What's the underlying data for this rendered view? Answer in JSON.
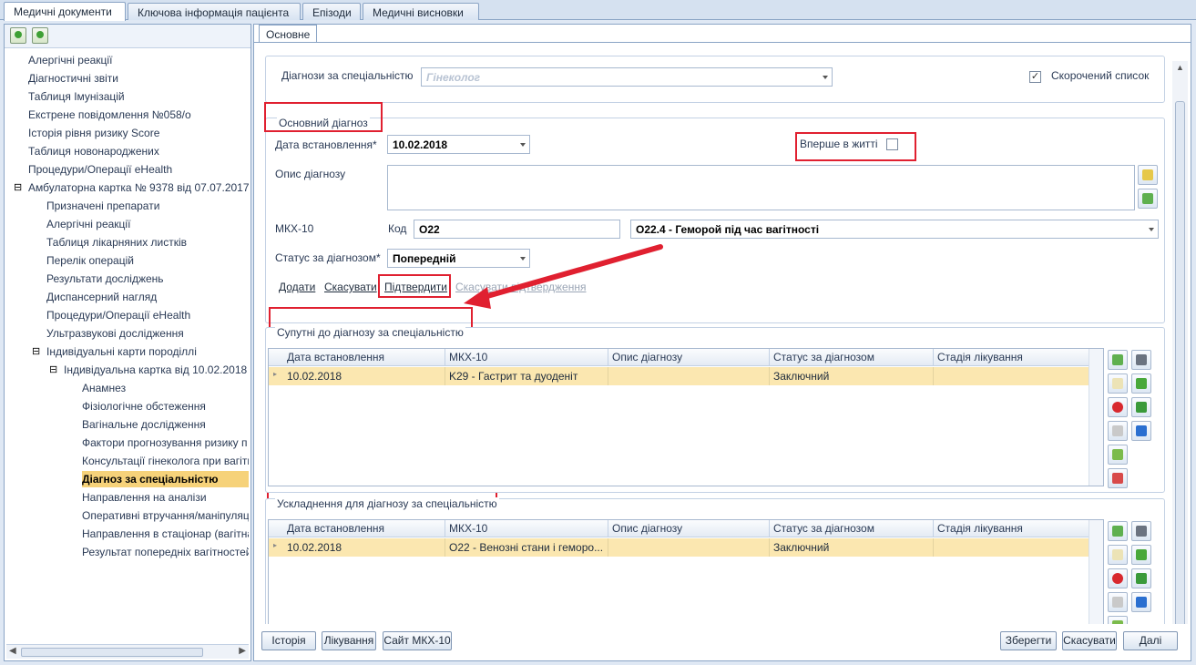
{
  "top_tabs": [
    "Медичні документи",
    "Ключова інформація пацієнта",
    "Епізоди",
    "Медичні висновки"
  ],
  "left_tree": [
    {
      "label": "Алергічні реакції",
      "level": 0
    },
    {
      "label": "Діагностичні звіти",
      "level": 0
    },
    {
      "label": "Таблиця Імунізацій",
      "level": 0
    },
    {
      "label": "Екстрене повідомлення №058/о",
      "level": 0
    },
    {
      "label": "Історія рівня ризику Score",
      "level": 0
    },
    {
      "label": "Таблиця новонароджених",
      "level": 0
    },
    {
      "label": "Процедури/Операції eHealth",
      "level": 0
    },
    {
      "label": "Амбулаторна картка № 9378 від 07.07.2017",
      "level": 0,
      "expander": "⊟"
    },
    {
      "label": "Призначені препарати",
      "level": 1
    },
    {
      "label": "Алергічні реакції",
      "level": 1
    },
    {
      "label": "Таблиця лікарняних листків",
      "level": 1
    },
    {
      "label": "Перелік операцій",
      "level": 1
    },
    {
      "label": "Результати досліджень",
      "level": 1
    },
    {
      "label": "Диспансерний нагляд",
      "level": 1
    },
    {
      "label": "Процедури/Операції eHealth",
      "level": 1
    },
    {
      "label": "Ультразвукові дослідження",
      "level": 1
    },
    {
      "label": "Індивідуальні карти породіллі",
      "level": 1,
      "expander": "⊟"
    },
    {
      "label": "Індивідуальна картка від 10.02.2018",
      "level": 2,
      "expander": "⊟"
    },
    {
      "label": "Анамнез",
      "level": 3
    },
    {
      "label": "Фізіологічне обстеження",
      "level": 3
    },
    {
      "label": "Вагінальне дослідження",
      "level": 3
    },
    {
      "label": "Фактори прогнозування ризику п",
      "level": 3
    },
    {
      "label": "Консультації гінеколога при вагітн",
      "level": 3
    },
    {
      "label": "Діагноз за спеціальністю",
      "level": 3,
      "selected": true
    },
    {
      "label": "Направлення на аналізи",
      "level": 3
    },
    {
      "label": "Оперативні втручання/маніпуляц",
      "level": 3
    },
    {
      "label": "Направлення в стаціонар (вагітна",
      "level": 3
    },
    {
      "label": "Результат попередніх вагітностей",
      "level": 3
    }
  ],
  "inner_tab": "Основне",
  "specialty": {
    "label": "Діагнози за спеціальністю",
    "value": "Гінеколог"
  },
  "short_list": {
    "label": "Скорочений список",
    "checked": "✓"
  },
  "main_diag": {
    "group_label": "Основний діагноз",
    "date_label": "Дата встановлення*",
    "date_value": "10.02.2018",
    "first_label": "Вперше в житті",
    "desc_label": "Опис діагнозу",
    "desc_value": "",
    "mkx_label": "МКХ-10",
    "code_label": "Код",
    "code_value": "O22",
    "mkx_value": "O22.4 - Геморой під час вагітності",
    "status_label": "Статус за діагнозом*",
    "status_value": "Попередній",
    "links": {
      "add": "Додати",
      "cancel": "Скасувати",
      "confirm": "Підтвердити",
      "cancel_confirm": "Скасувати підтвердження"
    }
  },
  "grid_headers": [
    "Дата встановлення",
    "МКХ-10",
    "Опис діагнозу",
    "Статус за діагнозом",
    "Стадія лікування"
  ],
  "concomitant": {
    "group_label": "Супутні до діагнозу за спеціальністю",
    "rows": [
      {
        "date": "10.02.2018",
        "mkx": "K29 - Гастрит та дуоденіт",
        "desc": "",
        "status": "Заключний",
        "stage": ""
      }
    ]
  },
  "complications": {
    "group_label": "Ускладнення для діагнозу за спеціальністю",
    "rows": [
      {
        "date": "10.02.2018",
        "mkx": "O22 - Венозні стани і геморо...",
        "desc": "",
        "status": "Заключний",
        "stage": ""
      }
    ]
  },
  "bottom_buttons": {
    "history": "Історія",
    "treatment": "Лікування",
    "site": "Сайт МКХ-10",
    "save": "Зберегти",
    "cancel": "Скасувати",
    "next": "Далі"
  },
  "colors": {
    "selected_row": "#fbe7b0",
    "highlight": "#e02030",
    "tree_selected": "#f6d27a"
  }
}
